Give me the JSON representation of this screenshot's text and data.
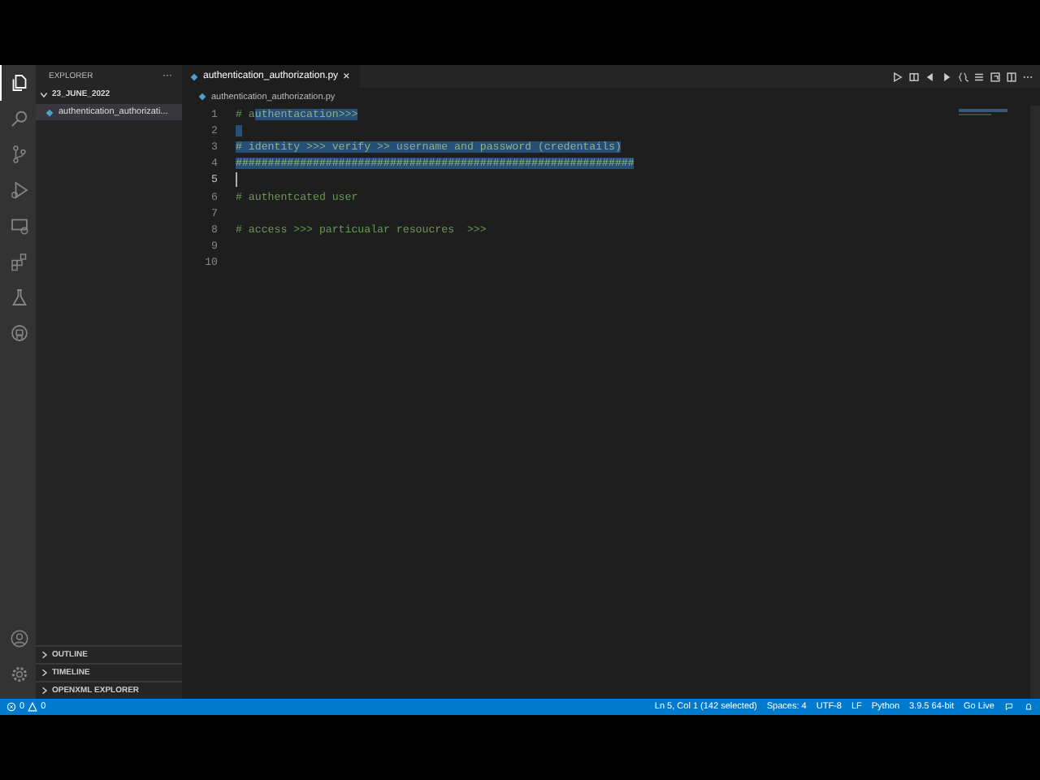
{
  "activity_bar": {
    "items": [
      {
        "kind": "files",
        "selected": true
      },
      {
        "kind": "search",
        "selected": false
      },
      {
        "kind": "source-control",
        "selected": false
      },
      {
        "kind": "run",
        "selected": false
      },
      {
        "kind": "remote",
        "selected": false
      },
      {
        "kind": "extensions",
        "selected": false
      },
      {
        "kind": "testing",
        "selected": false
      },
      {
        "kind": "github",
        "selected": false
      }
    ],
    "bottom": [
      {
        "kind": "account"
      },
      {
        "kind": "gear"
      }
    ]
  },
  "sidebar": {
    "title": "EXPLORER",
    "more": "···",
    "folder": {
      "name": "23_JUNE_2022",
      "expanded": true,
      "children": [
        {
          "name": "authentication_authorizati...",
          "selected": true
        }
      ]
    },
    "panels": [
      {
        "label": "OUTLINE",
        "expanded": false
      },
      {
        "label": "TIMELINE",
        "expanded": false
      },
      {
        "label": "OPENXML EXPLORER",
        "expanded": false
      }
    ]
  },
  "tabs": [
    {
      "label": "authentication_authorization.py",
      "selected": true,
      "close": "×"
    }
  ],
  "breadcrumb": "authentication_authorization.py",
  "lines": [
    {
      "number": "1",
      "segments": [
        {
          "text": "# a",
          "selected": false
        },
        {
          "text": "uthentacation>>>",
          "selected": true
        }
      ]
    },
    {
      "number": "2",
      "blank_selected": true
    },
    {
      "number": "3",
      "segments": [
        {
          "text": "# identity >>> verify >> username and password (credentails)",
          "selected": true
        }
      ]
    },
    {
      "number": "4",
      "segments": [
        {
          "text": "##############################################################",
          "selected": true
        }
      ]
    },
    {
      "number": "5",
      "cursor": true
    },
    {
      "number": "6",
      "segments": [
        {
          "text": "# authentcated user",
          "selected": false
        }
      ]
    },
    {
      "number": "7"
    },
    {
      "number": "8",
      "segments": [
        {
          "text": "# access >>> particualar resoucres  >>>",
          "selected": false
        }
      ]
    },
    {
      "number": "9"
    },
    {
      "number": "10"
    }
  ],
  "status_bar": {
    "errors": "0",
    "warnings": "0",
    "items": [
      "Ln 5, Col 1 (142 selected)",
      "Spaces: 4",
      "UTF-8",
      "LF",
      "Python",
      "3.9.5 64-bit",
      "Go Live"
    ]
  }
}
